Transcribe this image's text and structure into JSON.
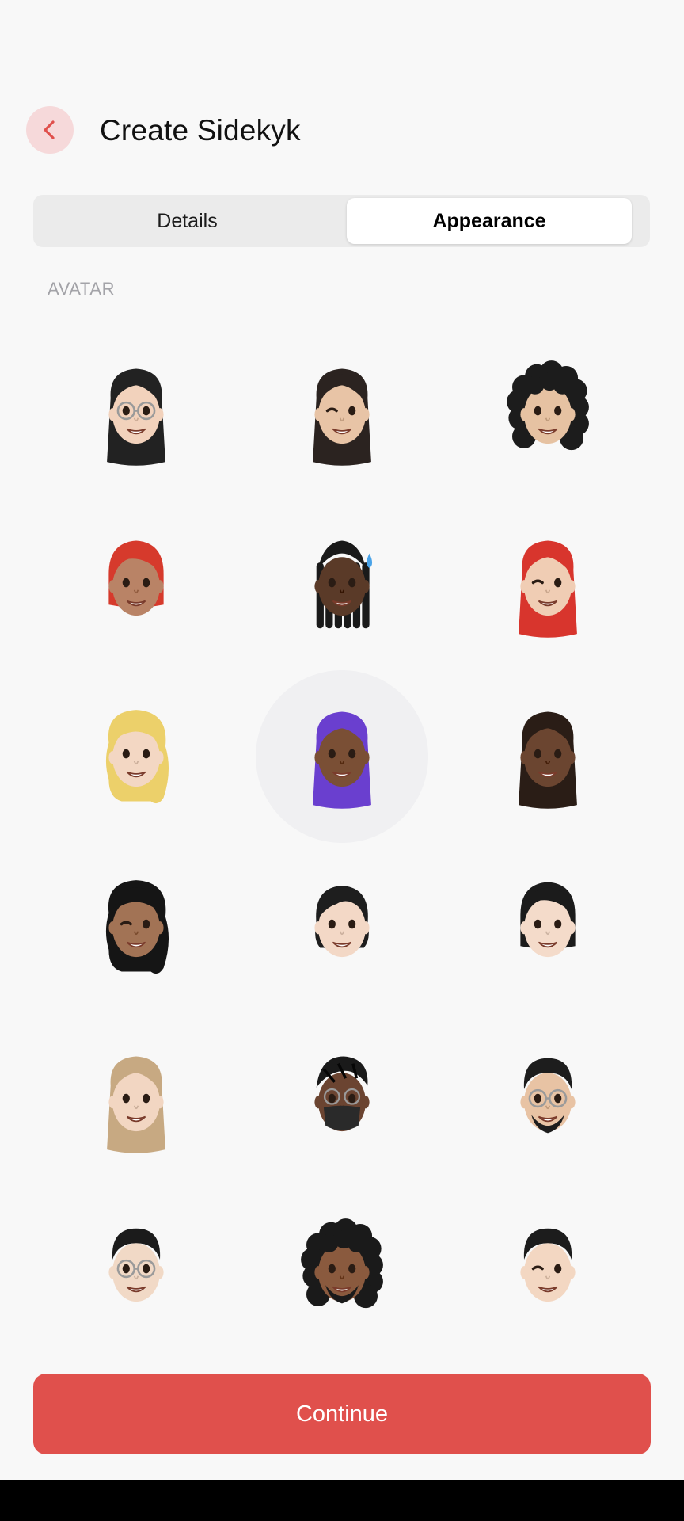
{
  "header": {
    "title": "Create Sidekyk"
  },
  "tabs": [
    {
      "label": "Details",
      "active": false
    },
    {
      "label": "Appearance",
      "active": true
    }
  ],
  "section": {
    "label": "AVATAR"
  },
  "avatars": [
    {
      "id": "avatar-1",
      "hair": "#222222",
      "skin": "#f2d2bc",
      "selected": false,
      "style": "long",
      "accessory": "glasses"
    },
    {
      "id": "avatar-2",
      "hair": "#2b2320",
      "skin": "#e8c4a6",
      "selected": false,
      "style": "long",
      "accessory": "wink"
    },
    {
      "id": "avatar-3",
      "hair": "#1c1c1c",
      "skin": "#e6c2a2",
      "selected": false,
      "style": "curly",
      "accessory": "none"
    },
    {
      "id": "avatar-4",
      "hair": "#d63a2c",
      "skin": "#b98366",
      "selected": false,
      "style": "bob",
      "accessory": "none"
    },
    {
      "id": "avatar-5",
      "hair": "#1a1a1a",
      "skin": "#5a3a28",
      "selected": false,
      "style": "braids",
      "accessory": "sweat"
    },
    {
      "id": "avatar-6",
      "hair": "#d8352d",
      "skin": "#f0cdb4",
      "selected": false,
      "style": "long",
      "accessory": "wink"
    },
    {
      "id": "avatar-7",
      "hair": "#ecd06a",
      "skin": "#f3d7c3",
      "selected": false,
      "style": "wavy",
      "accessory": "none"
    },
    {
      "id": "avatar-8",
      "hair": "#6a3fcf",
      "skin": "#7a4f35",
      "selected": true,
      "style": "long",
      "accessory": "none"
    },
    {
      "id": "avatar-9",
      "hair": "#2a1d16",
      "skin": "#6b4530",
      "selected": false,
      "style": "long",
      "accessory": "none"
    },
    {
      "id": "avatar-10",
      "hair": "#151515",
      "skin": "#a27355",
      "selected": false,
      "style": "wavy",
      "accessory": "wink"
    },
    {
      "id": "avatar-11",
      "hair": "#1e1e1e",
      "skin": "#f3d8c6",
      "selected": false,
      "style": "updo",
      "accessory": "none"
    },
    {
      "id": "avatar-12",
      "hair": "#1b1b1b",
      "skin": "#f4dbca",
      "selected": false,
      "style": "bob",
      "accessory": "none"
    },
    {
      "id": "avatar-13",
      "hair": "#c7a982",
      "skin": "#f2d6c2",
      "selected": false,
      "style": "long",
      "accessory": "none"
    },
    {
      "id": "avatar-14",
      "hair": "#1a1a1a",
      "skin": "#6b4431",
      "selected": false,
      "style": "locs",
      "accessory": "mask"
    },
    {
      "id": "avatar-15",
      "hair": "#1d1d1d",
      "skin": "#e8c3a4",
      "selected": false,
      "style": "short",
      "accessory": "glasses-beard"
    },
    {
      "id": "avatar-16",
      "hair": "#1b1b1b",
      "skin": "#f1d9c6",
      "selected": false,
      "style": "short",
      "accessory": "glasses"
    },
    {
      "id": "avatar-17",
      "hair": "#1a1a1a",
      "skin": "#8a5a3e",
      "selected": false,
      "style": "curly",
      "accessory": "goatee"
    },
    {
      "id": "avatar-18",
      "hair": "#1c1c1c",
      "skin": "#f3d7c2",
      "selected": false,
      "style": "short",
      "accessory": "wink"
    }
  ],
  "footer": {
    "continue_label": "Continue"
  },
  "colors": {
    "accent": "#e0504c",
    "back_bg": "#f6d9da",
    "back_icon": "#e0504c"
  }
}
